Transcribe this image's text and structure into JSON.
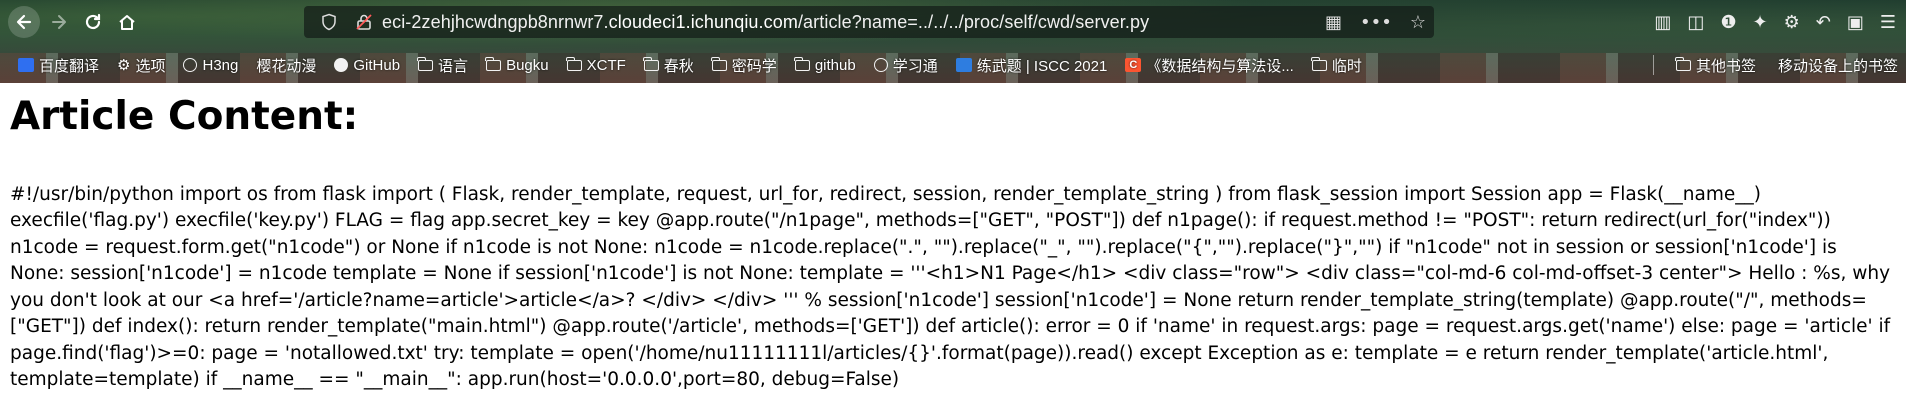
{
  "browser": {
    "url_prefix": "eci-2zehjhcwdngpb8nrnwr7.",
    "url_host": "cloudeci1.ichunqiu.com",
    "url_path": "/article?name=../../../proc/self/cwd/server.py",
    "bookmarks": [
      {
        "label": "百度翻译",
        "icon": "baidu-icon"
      },
      {
        "label": "选项",
        "icon": "gear-icon"
      },
      {
        "label": "H3ng",
        "icon": "globe-icon"
      },
      {
        "label": "樱花动漫",
        "icon": "none"
      },
      {
        "label": "GitHub",
        "icon": "github-icon"
      },
      {
        "label": "语言",
        "icon": "folder-icon"
      },
      {
        "label": "Bugku",
        "icon": "folder-icon"
      },
      {
        "label": "XCTF",
        "icon": "folder-icon"
      },
      {
        "label": "春秋",
        "icon": "folder-icon"
      },
      {
        "label": "密码学",
        "icon": "folder-icon"
      },
      {
        "label": "github",
        "icon": "folder-icon"
      },
      {
        "label": "学习通",
        "icon": "globe-icon"
      },
      {
        "label": "练武题 | ISCC 2021",
        "icon": "iscc-icon"
      },
      {
        "label": "《数据结构与算法设...",
        "icon": "csdn-icon"
      },
      {
        "label": "临时",
        "icon": "folder-icon"
      }
    ],
    "bookmarks_right": [
      {
        "label": "其他书签",
        "icon": "folder-icon"
      },
      {
        "label": "移动设备上的书签",
        "icon": "none"
      }
    ]
  },
  "page": {
    "title": "Article Content:",
    "body": "#!/usr/bin/python import os from flask import ( Flask, render_template, request, url_for, redirect, session, render_template_string ) from flask_session import Session app = Flask(__name__) execfile('flag.py') execfile('key.py') FLAG = flag app.secret_key = key @app.route(\"/n1page\", methods=[\"GET\", \"POST\"]) def n1page(): if request.method != \"POST\": return redirect(url_for(\"index\")) n1code = request.form.get(\"n1code\") or None if n1code is not None: n1code = n1code.replace(\".\", \"\").replace(\"_\", \"\").replace(\"{\",\"\").replace(\"}\",\"\") if \"n1code\" not in session or session['n1code'] is None: session['n1code'] = n1code template = None if session['n1code'] is not None: template = '''<h1>N1 Page</h1> <div class=\"row\"> <div class=\"col-md-6 col-md-offset-3 center\"> Hello : %s, why you don't look at our <a href='/article?name=article'>article</a>? </div> </div> ''' % session['n1code'] session['n1code'] = None return render_template_string(template) @app.route(\"/\", methods=[\"GET\"]) def index(): return render_template(\"main.html\") @app.route('/article', methods=['GET']) def article(): error = 0 if 'name' in request.args: page = request.args.get('name') else: page = 'article' if page.find('flag')>=0: page = 'notallowed.txt' try: template = open('/home/nu11111111l/articles/{}'.format(page)).read() except Exception as e: template = e return render_template('article.html', template=template) if __name__ == \"__main__\": app.run(host='0.0.0.0',port=80, debug=False)"
  }
}
